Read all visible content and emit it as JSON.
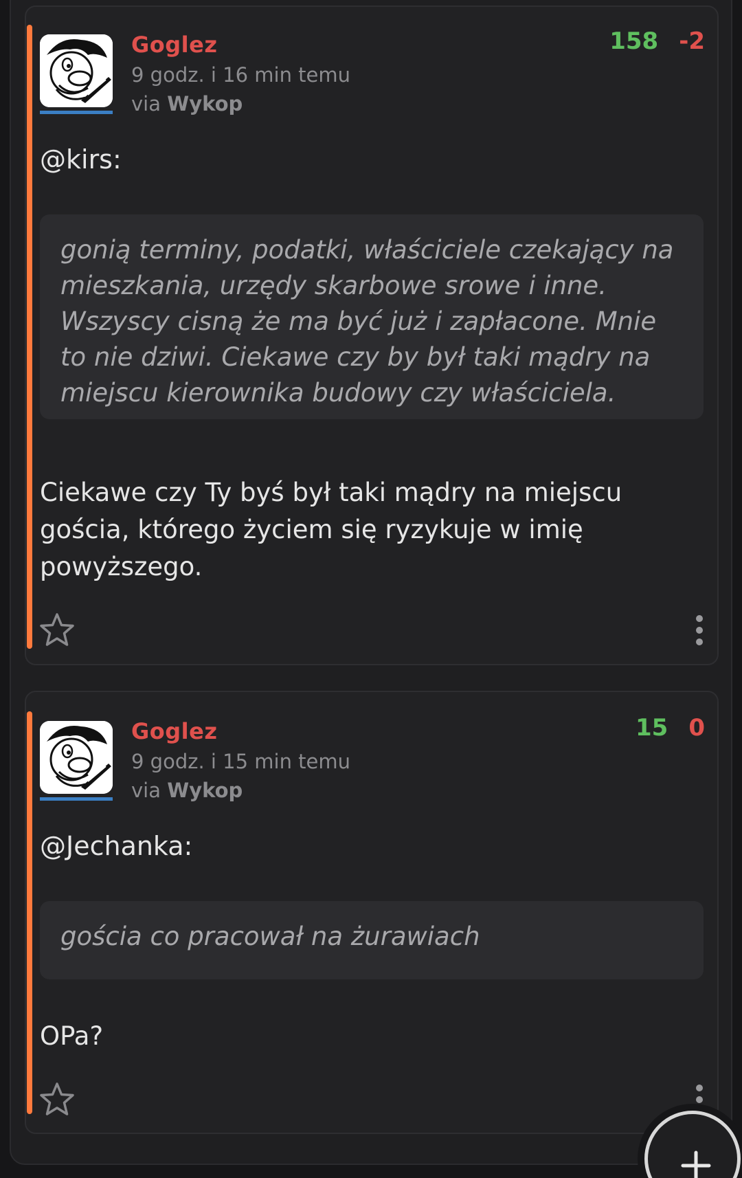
{
  "comments": [
    {
      "author": "Goglez",
      "time": "9 godz. i 16 min temu",
      "via_prefix": "via",
      "via_app": "Wykop",
      "votes_up": "158",
      "votes_down": "-2",
      "mention": "@kirs:",
      "quote": "gonią terminy, podatki, właściciele czekający na mieszkania, urzędy skarbowe srowe i inne. Wszyscy cisną że ma być już i zapłacone. Mnie to nie dziwi. Ciekawe czy by był taki mądry na miejscu kierownika budowy czy właściciela.",
      "body": "Ciekawe czy Ty byś był taki mądry na miejscu gościa, którego życiem się ryzykuje w imię powyższego."
    },
    {
      "author": "Goglez",
      "time": "9 godz. i 15 min temu",
      "via_prefix": "via",
      "via_app": "Wykop",
      "votes_up": "15",
      "votes_down": "0",
      "mention": "@Jechanka:",
      "quote": "gościa co pracował na żurawiach",
      "body": "OPa?"
    }
  ],
  "icons": {
    "favorite": "star-outline-icon",
    "more": "vertical-dots-icon",
    "add": "plus-icon"
  },
  "colors": {
    "accent": "#ff7a3d",
    "author": "#e0514d",
    "vote_up": "#5fbf5f",
    "vote_down": "#e0514d",
    "avatar_underline": "#3b7fc4"
  }
}
